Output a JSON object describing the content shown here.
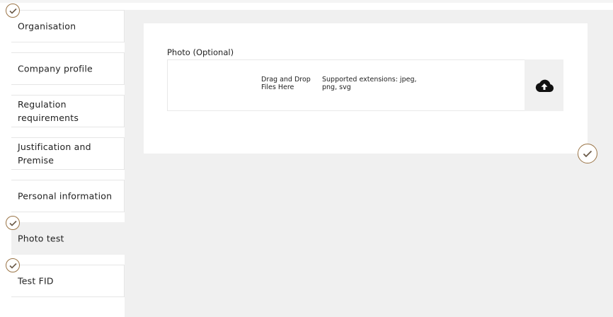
{
  "sidebar": {
    "steps": [
      {
        "label": "Organisation",
        "completed": true
      },
      {
        "label": "Company profile",
        "completed": false
      },
      {
        "label": "Regulation requirements",
        "completed": false
      },
      {
        "label": "Justification and Premise",
        "completed": false
      },
      {
        "label": "Personal information",
        "completed": false
      },
      {
        "label": "Photo test",
        "completed": true,
        "active": true
      },
      {
        "label": "Test FID",
        "completed": true
      }
    ]
  },
  "form": {
    "photo_label": "Photo (Optional)",
    "dropzone": {
      "drag_text": "Drag and Drop Files Here",
      "extensions_text": "Supported extensions: jpeg, png, svg",
      "upload_icon": "cloud-upload-icon"
    },
    "section_status_icon": "check-circle-icon"
  },
  "colors": {
    "accent": "#9a7446",
    "background": "#f0f0f0",
    "card": "#ffffff"
  }
}
